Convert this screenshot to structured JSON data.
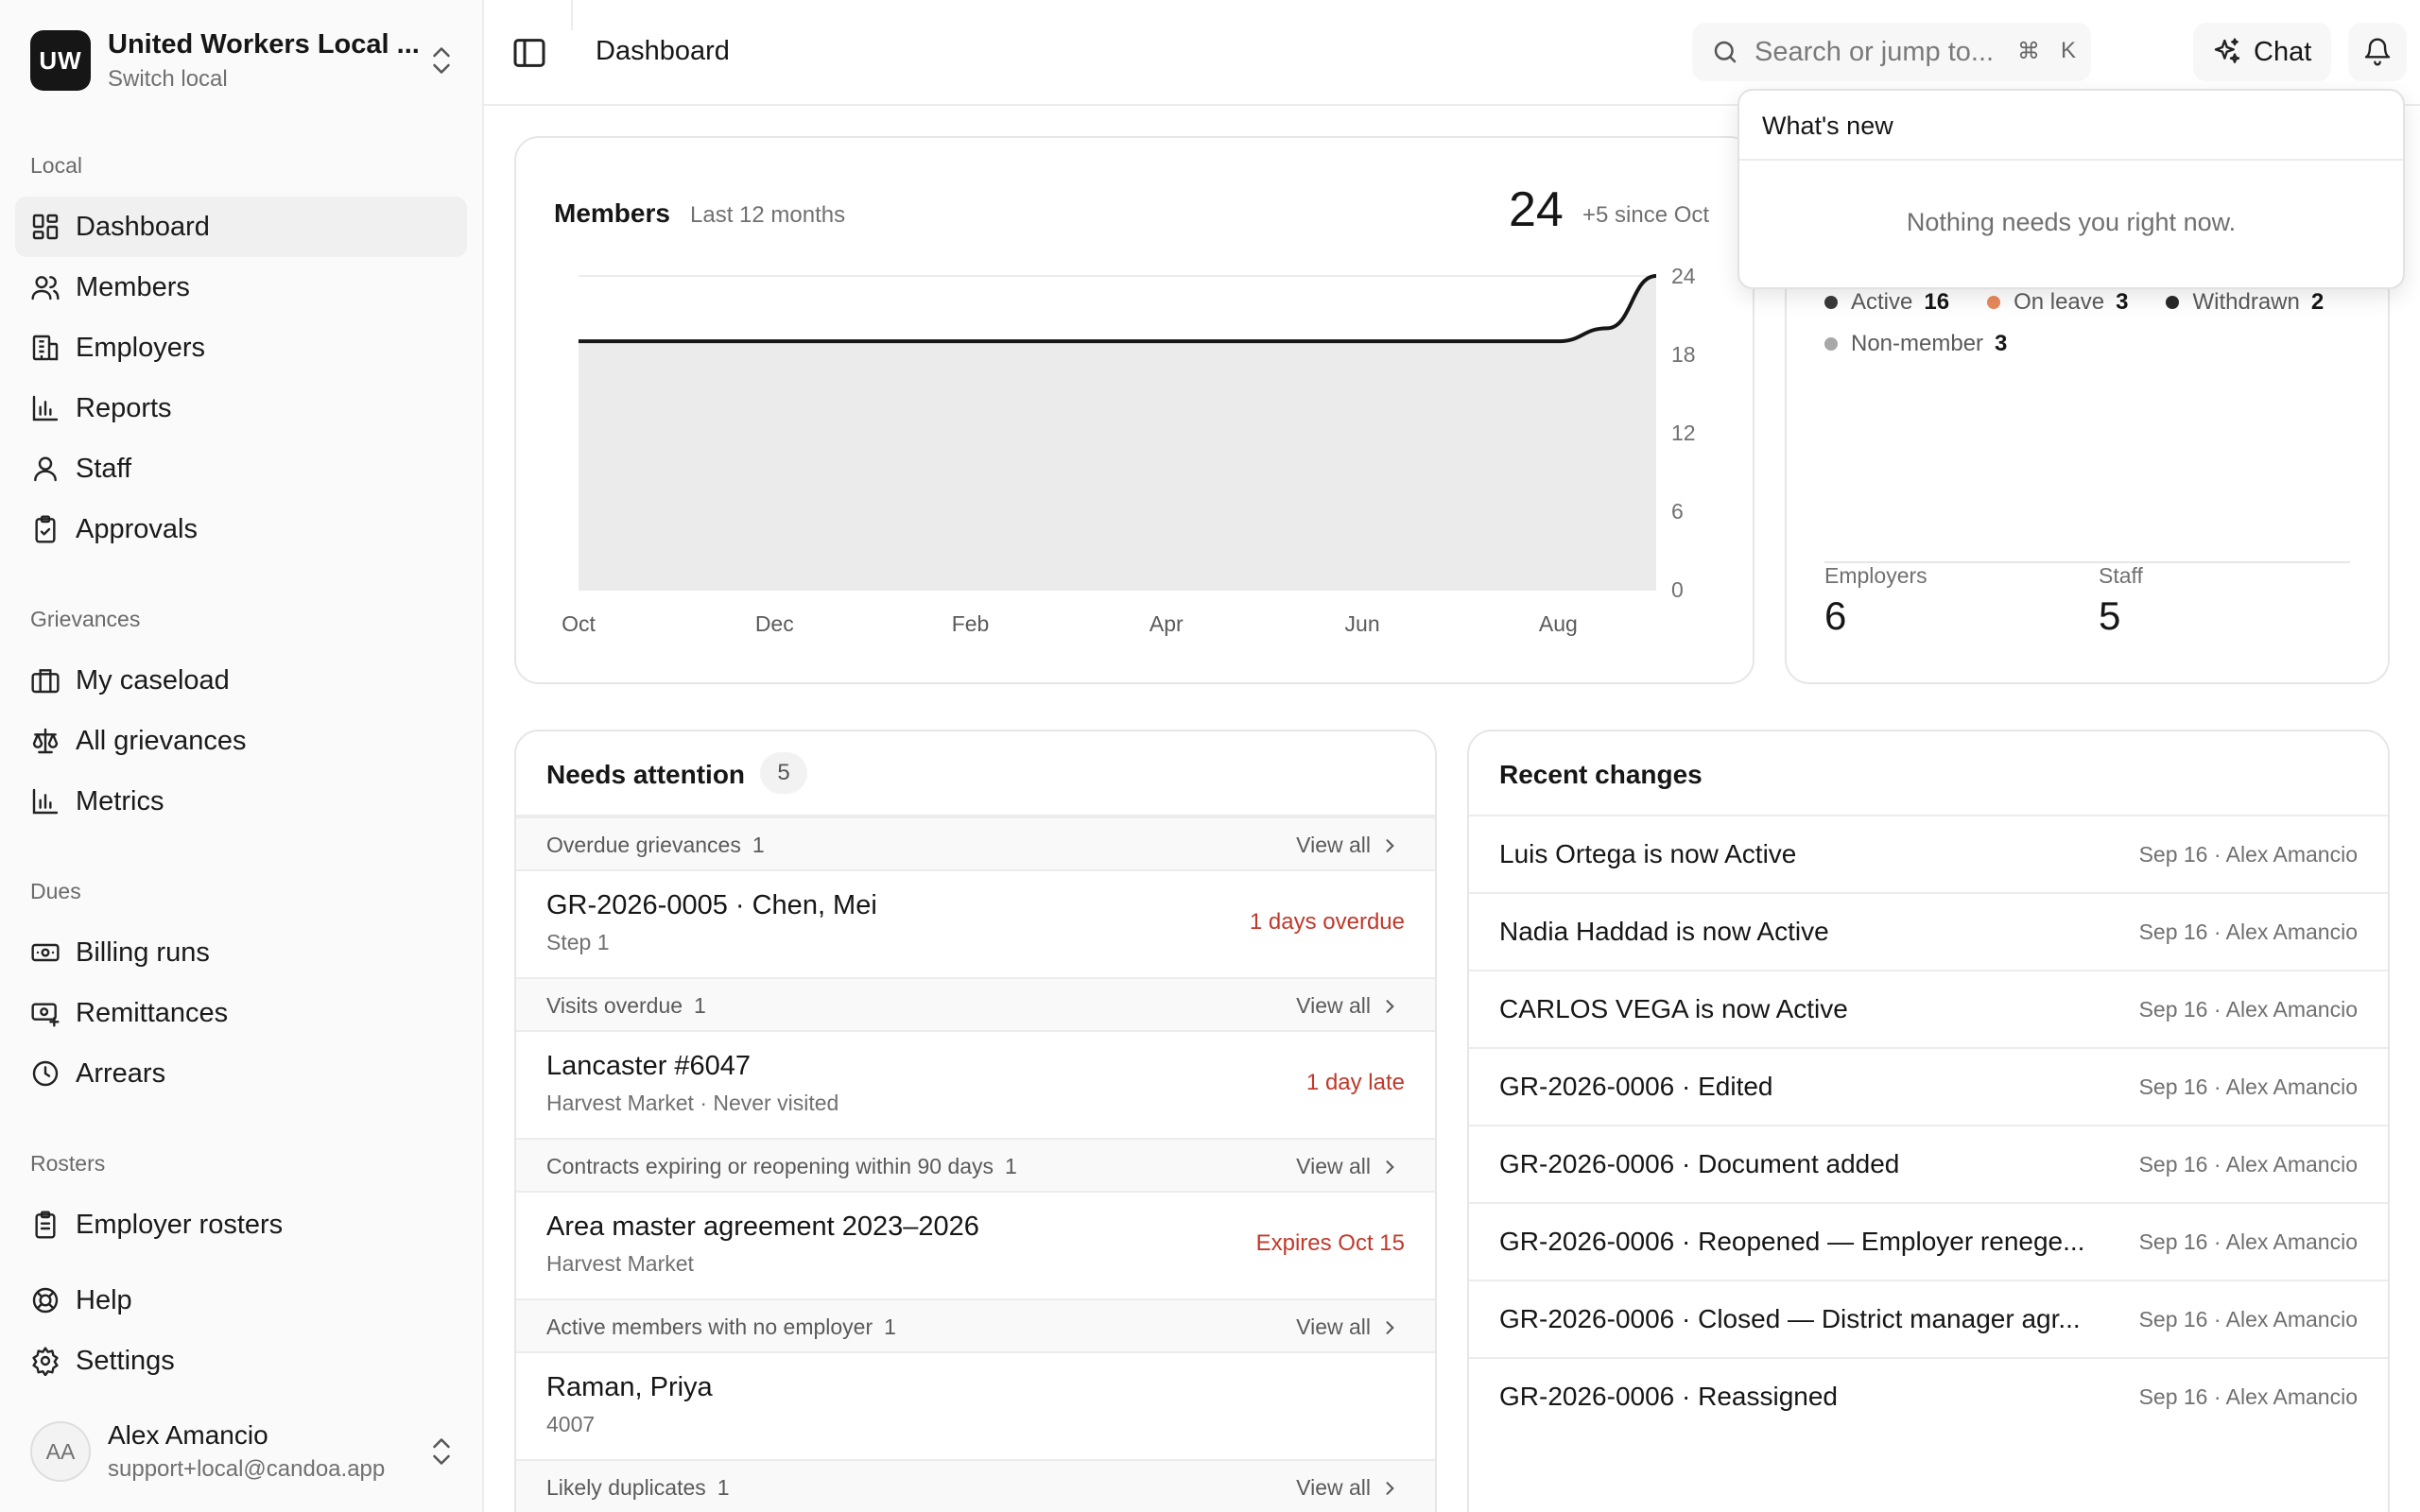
{
  "org": {
    "initials": "UW",
    "name": "United Workers Local ...",
    "sub": "Switch local"
  },
  "sidebar": {
    "sections": [
      {
        "label": "Local",
        "items": [
          "Dashboard",
          "Members",
          "Employers",
          "Reports",
          "Staff",
          "Approvals"
        ]
      },
      {
        "label": "Grievances",
        "items": [
          "My caseload",
          "All grievances",
          "Metrics"
        ]
      },
      {
        "label": "Dues",
        "items": [
          "Billing runs",
          "Remittances",
          "Arrears"
        ]
      },
      {
        "label": "Rosters",
        "items": [
          "Employer rosters"
        ]
      }
    ],
    "bottom": [
      "Help",
      "Settings"
    ]
  },
  "user": {
    "initials": "AA",
    "name": "Alex Amancio",
    "email": "support+local@candoa.app"
  },
  "topbar": {
    "title": "Dashboard",
    "search_placeholder": "Search or jump to...",
    "kbd_cmd": "⌘",
    "kbd_key": "K",
    "chat_label": "Chat"
  },
  "members_card": {
    "title": "Members",
    "subtitle": "Last 12 months",
    "count": "24",
    "delta": "+5 since Oct"
  },
  "chart_data": {
    "type": "area",
    "x_ticks": [
      "Oct",
      "Dec",
      "Feb",
      "Apr",
      "Jun",
      "Aug"
    ],
    "y_ticks": [
      0,
      6,
      12,
      18,
      24
    ],
    "ylim": [
      0,
      24
    ],
    "series": [
      {
        "points": [
          [
            0,
            19
          ],
          [
            1,
            19
          ],
          [
            2,
            19
          ],
          [
            3,
            19
          ],
          [
            4,
            19
          ],
          [
            5,
            19
          ],
          [
            6,
            19
          ],
          [
            7,
            19
          ],
          [
            8,
            19
          ],
          [
            9,
            19
          ],
          [
            10,
            19
          ],
          [
            10.5,
            20
          ],
          [
            11,
            24
          ]
        ]
      }
    ],
    "x_range": [
      0,
      11
    ],
    "grid": true
  },
  "status_card": {
    "statuses": [
      {
        "label": "Active",
        "value": "16",
        "color": "#3a3a3a"
      },
      {
        "label": "On leave",
        "value": "3",
        "color": "#e8895c"
      },
      {
        "label": "Withdrawn",
        "value": "2",
        "color": "#2a2a2a"
      },
      {
        "label": "Non-member",
        "value": "3",
        "color": "#a8a8a8"
      }
    ],
    "employers_label": "Employers",
    "employers_value": "6",
    "staff_label": "Staff",
    "staff_value": "5"
  },
  "attention": {
    "title": "Needs attention",
    "count": "5",
    "view_all": "View all",
    "groups": [
      {
        "label": "Overdue grievances",
        "count": "1",
        "item_title": "GR-2026-0005 · Chen, Mei",
        "item_sub": "Step 1",
        "flag": "1 days overdue"
      },
      {
        "label": "Visits overdue",
        "count": "1",
        "item_title": "Lancaster #6047",
        "item_sub": "Harvest Market · Never visited",
        "flag": "1 day late"
      },
      {
        "label": "Contracts expiring or reopening within 90 days",
        "count": "1",
        "item_title": "Area master agreement 2023–2026",
        "item_sub": "Harvest Market",
        "flag": "Expires Oct 15"
      },
      {
        "label": "Active members with no employer",
        "count": "1",
        "item_title": "Raman, Priya",
        "item_sub": "4007",
        "flag": ""
      },
      {
        "label": "Likely duplicates",
        "count": "1"
      }
    ]
  },
  "recent": {
    "title": "Recent changes",
    "rows": [
      {
        "text": "Luis Ortega is now Active",
        "meta": "Sep 16 · Alex Amancio"
      },
      {
        "text": "Nadia Haddad is now Active",
        "meta": "Sep 16 · Alex Amancio"
      },
      {
        "text": "CARLOS VEGA is now Active",
        "meta": "Sep 16 · Alex Amancio"
      },
      {
        "text": "GR-2026-0006 · Edited",
        "meta": "Sep 16 · Alex Amancio"
      },
      {
        "text": "GR-2026-0006 · Document added",
        "meta": "Sep 16 · Alex Amancio"
      },
      {
        "text": "GR-2026-0006 · Reopened — Employer renege...",
        "meta": "Sep 16 · Alex Amancio"
      },
      {
        "text": "GR-2026-0006 · Closed — District manager agr...",
        "meta": "Sep 16 · Alex Amancio"
      },
      {
        "text": "GR-2026-0006 · Reassigned",
        "meta": "Sep 16 · Alex Amancio"
      }
    ]
  },
  "whats_new": {
    "title": "What's new",
    "empty": "Nothing needs you right now."
  }
}
